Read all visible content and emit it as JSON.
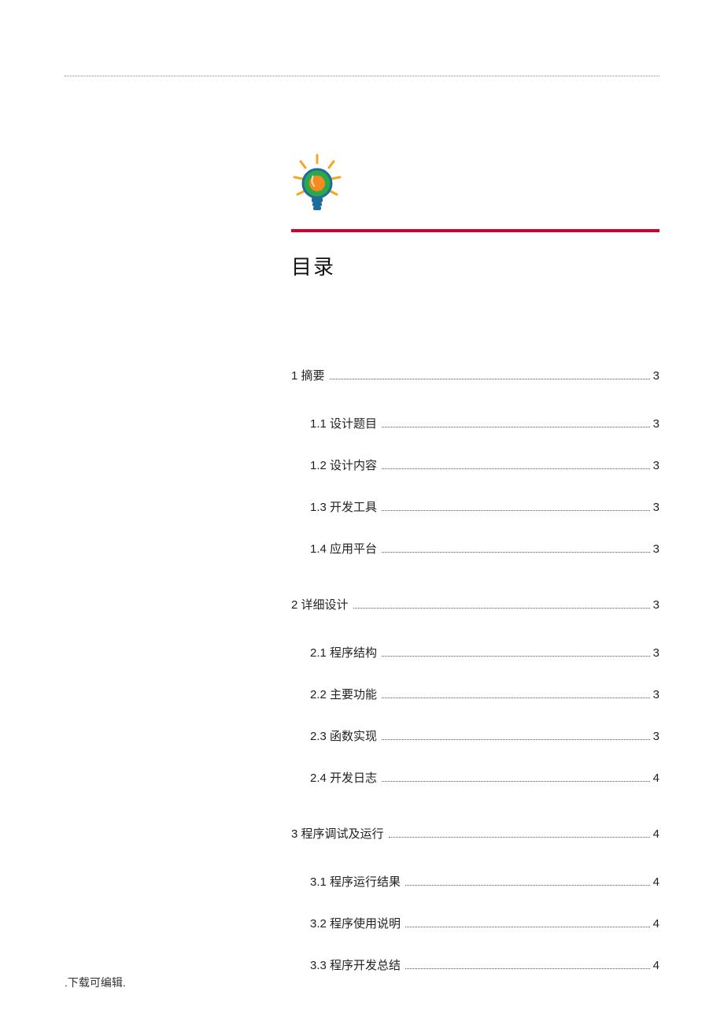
{
  "title": "目录",
  "footer": ".下载可编辑.",
  "icon_name": "lightbulb-icon",
  "toc": [
    {
      "level": 1,
      "label": "1 摘要",
      "page": "3"
    },
    {
      "level": 2,
      "label": "1.1 设计题目",
      "page": "3"
    },
    {
      "level": 2,
      "label": "1.2 设计内容",
      "page": "3"
    },
    {
      "level": 2,
      "label": "1.3 开发工具",
      "page": "3"
    },
    {
      "level": 2,
      "label": "1.4 应用平台",
      "page": "3"
    },
    {
      "level": 1,
      "label": "2 详细设计",
      "page": "3"
    },
    {
      "level": 2,
      "label": "2.1 程序结构",
      "page": "3"
    },
    {
      "level": 2,
      "label": "2.2 主要功能",
      "page": "3"
    },
    {
      "level": 2,
      "label": "2.3 函数实现",
      "page": "3"
    },
    {
      "level": 2,
      "label": "2.4 开发日志",
      "page": "4"
    },
    {
      "level": 1,
      "label": "3 程序调试及运行",
      "page": "4"
    },
    {
      "level": 2,
      "label": "3.1 程序运行结果",
      "page": "4"
    },
    {
      "level": 2,
      "label": "3.2 程序使用说明",
      "page": "4"
    },
    {
      "level": 2,
      "label": "3.3 程序开发总结",
      "page": "4"
    }
  ]
}
